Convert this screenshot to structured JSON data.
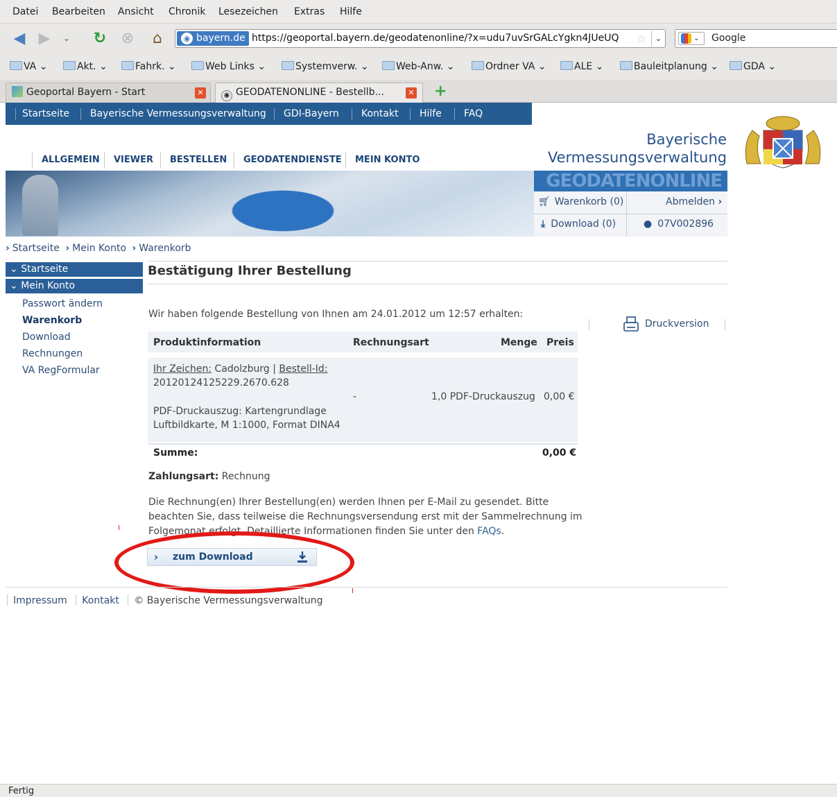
{
  "browser": {
    "menu": [
      "Datei",
      "Bearbeiten",
      "Ansicht",
      "Chronik",
      "Lesezeichen",
      "Extras",
      "Hilfe"
    ],
    "site_badge": "bayern.de",
    "url": "https://geoportal.bayern.de/geodatenonline/?x=udu7uvSrGALcYgkn4JUeUQ",
    "search_placeholder": "Google",
    "bookmarks": [
      "VA",
      "Akt.",
      "Fahrk.",
      "Web Links",
      "Systemverw.",
      "Web-Anw.",
      "Ordner VA",
      "ALE",
      "Bauleitplanung",
      "GDA"
    ],
    "tabs": [
      {
        "title": "Geoportal Bayern - Start"
      },
      {
        "title": "GEODATENONLINE - Bestellb..."
      }
    ],
    "status": "Fertig"
  },
  "topnav": [
    "Startseite",
    "Bayerische Vermessungsverwaltung",
    "GDI-Bayern",
    "Kontakt",
    "Hilfe",
    "FAQ"
  ],
  "mainnav": [
    "ALLGEMEIN",
    "VIEWER",
    "BESTELLEN",
    "GEODATENDIENSTE",
    "MEIN KONTO"
  ],
  "brand": {
    "line1": "Bayerische",
    "line2": "Vermessungsverwaltung",
    "product": "GEODATENONLINE"
  },
  "account": {
    "cart": "Warenkorb (0)",
    "logout": "Abmelden",
    "download": "Download (0)",
    "user_id": "07V002896"
  },
  "breadcrumb": [
    "Startseite",
    "Mein Konto",
    "Warenkorb"
  ],
  "sidebar": {
    "sections": [
      "Startseite",
      "Mein Konto"
    ],
    "items": [
      "Passwort ändern",
      "Warenkorb",
      "Download",
      "Rechnungen",
      "VA RegFormular"
    ],
    "active": "Warenkorb"
  },
  "main": {
    "title": "Bestätigung Ihrer Bestellung",
    "intro": "Wir haben folgende Bestellung von Ihnen am 24.01.2012 um 12:57 erhalten:",
    "print_label": "Druckversion",
    "table": {
      "headers": [
        "Produktinformation",
        "Rechnungsart",
        "Menge",
        "Preis"
      ],
      "row": {
        "zeichen_label": "Ihr Zeichen:",
        "zeichen_value": "Cadolzburg",
        "sep": "|",
        "bestell_label": "Bestell-Id:",
        "bestell_id": "20120124125229.2670.628",
        "product_line1": "PDF-Druckauszug: Kartengrundlage",
        "product_line2": "Luftbildkarte, M 1:1000, Format DINA4",
        "rechnungsart": "-",
        "menge": "1,0 PDF-Druckauszug",
        "preis": "0,00 €"
      },
      "sum_label": "Summe:",
      "sum_value": "0,00 €"
    },
    "payment_label": "Zahlungsart:",
    "payment_value": "Rechnung",
    "notice_text": "Die Rechnung(en) Ihrer Bestellung(en) werden Ihnen per E-Mail zu gesendet. Bitte beachten Sie, dass teilweise die Rechnungsversendung erst mit der Sammelrechnung im Folgemonat erfolgt. Detaillierte Informationen finden Sie unter den ",
    "notice_link": "FAQs",
    "notice_end": ".",
    "download_button": "zum Download"
  },
  "footer": [
    "Impressum",
    "Kontakt",
    "© Bayerische Vermessungsverwaltung"
  ],
  "colors": {
    "nav_blue": "#255c91",
    "highlight_red": "#e21a17",
    "brand_blue": "#27528a"
  }
}
